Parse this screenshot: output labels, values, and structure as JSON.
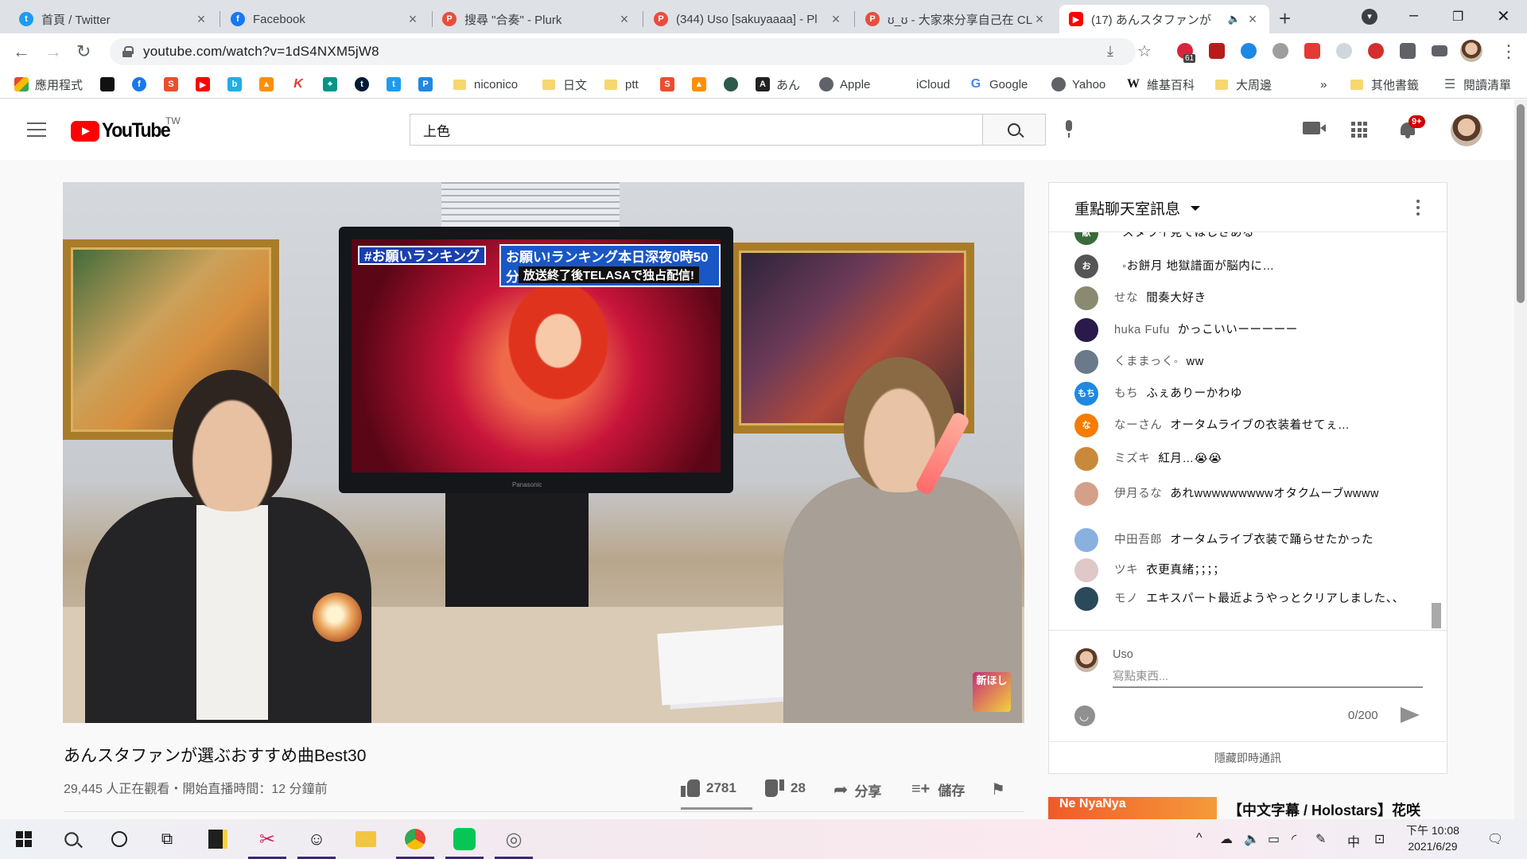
{
  "browser": {
    "tabs": [
      {
        "label": "首頁 / Twitter",
        "icon": "twitter-icon",
        "color": "#1d9bf0"
      },
      {
        "label": "Facebook",
        "icon": "facebook-icon",
        "color": "#1877f2"
      },
      {
        "label": "搜尋 \"合奏\" - Plurk",
        "icon": "plurk-icon",
        "color": "#e84e3c"
      },
      {
        "label": "(344) Uso [sakuyaaaa] - Pl",
        "icon": "plurk-icon",
        "color": "#e84e3c"
      },
      {
        "label": "ʊ_ʊ - 大家來分享自己在 CL",
        "icon": "plurk-icon",
        "color": "#e84e3c"
      },
      {
        "label": "(17) あんスタファンが",
        "icon": "youtube-icon",
        "color": "#ff0000",
        "active": true
      }
    ],
    "url": "youtube.com/watch?v=1dS4NXM5jW8",
    "extension_badge": "61",
    "bookmarks": [
      {
        "label": "應用程式",
        "icon": "apps-grid-icon"
      },
      {
        "label": "",
        "icon": "apple-black-icon"
      },
      {
        "label": "",
        "icon": "facebook-icon"
      },
      {
        "label": "",
        "icon": "shopping-bag-icon"
      },
      {
        "label": "",
        "icon": "youtube-icon"
      },
      {
        "label": "",
        "icon": "bilibili-icon"
      },
      {
        "label": "",
        "icon": "fire-icon"
      },
      {
        "label": "",
        "icon": "k-icon"
      },
      {
        "label": "",
        "icon": "map-icon"
      },
      {
        "label": "",
        "icon": "tumblr-icon"
      },
      {
        "label": "",
        "icon": "twitter-icon"
      },
      {
        "label": "",
        "icon": "p-icon"
      },
      {
        "label": "niconico",
        "icon": "folder-icon"
      },
      {
        "label": "日文",
        "icon": "folder-icon"
      },
      {
        "label": "ptt",
        "icon": "folder-icon"
      },
      {
        "label": "",
        "icon": "shopping-bag-icon"
      },
      {
        "label": "",
        "icon": "fire-icon"
      },
      {
        "label": "",
        "icon": "circle-icon"
      },
      {
        "label": "あん",
        "icon": "anime-icon"
      },
      {
        "label": "Apple",
        "icon": "globe-icon"
      },
      {
        "label": "iCloud",
        "icon": "apple-icon"
      },
      {
        "label": "Google",
        "icon": "google-icon"
      },
      {
        "label": "Yahoo",
        "icon": "globe-icon"
      },
      {
        "label": "維基百科",
        "icon": "wikipedia-icon"
      },
      {
        "label": "大周邊",
        "icon": "folder-icon"
      },
      {
        "label": "其他書籤",
        "icon": "folder-icon"
      },
      {
        "label": "閱讀清單",
        "icon": "reading-list-icon"
      }
    ],
    "bookmarks_more": "»"
  },
  "youtube": {
    "logo_text": "YouTube",
    "country": "TW",
    "search_value": "上色",
    "notifications_badge": "9+",
    "video": {
      "title": "あんスタファンが選ぶおすすめ曲Best30",
      "meta": "29,445 人正在觀看・開始直播時間：12 分鐘前",
      "likes": "2781",
      "dislikes": "28",
      "share_label": "分享",
      "save_label": "儲存",
      "tv_banner_1": "#お願いランキング",
      "tv_banner_2": "お願い!ランキング本日深夜0時50分~",
      "tv_banner_3": "放送終了後TELASAで独占配信!",
      "tv_brand": "Panasonic",
      "corner_logo": "新ほし"
    },
    "chat": {
      "title": "重點聊天室訊息",
      "messages": [
        {
          "author": "",
          "text": "スタライ見てほしさある",
          "avatar_color": "#3a6b3a",
          "avatar_text": "献"
        },
        {
          "author": "",
          "text": "◦お餅月 地獄譜面が脳内に…",
          "avatar_color": "#555555",
          "avatar_text": "お"
        },
        {
          "author": "せな",
          "text": "間奏大好き",
          "avatar_color": "#8a8a70",
          "avatar_text": ""
        },
        {
          "author": "huka Fufu",
          "text": "かっこいいーーーーー",
          "avatar_color": "#2a1a4a",
          "avatar_text": ""
        },
        {
          "author": "くままっく◦",
          "text": "ww",
          "avatar_color": "#6a7a8a",
          "avatar_text": ""
        },
        {
          "author": "もち",
          "text": "ふぇありーかわゆ",
          "avatar_color": "#1e88e5",
          "avatar_text": "もち"
        },
        {
          "author": "なーさん",
          "text": "オータムライブの衣装着せてぇ…",
          "avatar_color": "#f57c00",
          "avatar_text": "な"
        },
        {
          "author": "ミズキ",
          "text": "紅月…😭😭",
          "avatar_color": "#c88a3a",
          "avatar_text": ""
        },
        {
          "author": "伊月るな",
          "text": "あれwwwwwwwwwオタクムーブwwww",
          "avatar_color": "#d4a08a",
          "avatar_text": ""
        },
        {
          "author": "中田吾郎",
          "text": "オータムライブ衣装で踊らせたかった",
          "avatar_color": "#8ab0e0",
          "avatar_text": ""
        },
        {
          "author": "ツキ",
          "text": "衣更真緒；；；；",
          "avatar_color": "#e0c8c8",
          "avatar_text": ""
        },
        {
          "author": "モノ",
          "text": "エキスパート最近ようやっとクリアしました、、",
          "avatar_color": "#2a4a5a",
          "avatar_text": ""
        }
      ],
      "user_name": "Uso",
      "input_placeholder": "寫點東西...",
      "char_counter": "0/200",
      "hide_chat": "隱藏即時通訊"
    },
    "recommendation": {
      "thumb_text": "Ne NyaNya",
      "title": "【中文字幕 / Holostars】花咲"
    }
  },
  "taskbar": {
    "apps": [
      "windows-start-icon",
      "search-icon",
      "cortana-icon",
      "task-view-icon",
      "sticky-notes-icon",
      "snipping-tool-icon",
      "line-art-icon",
      "file-explorer-icon",
      "chrome-icon",
      "line-icon",
      "app-swirl-icon"
    ],
    "ime": "中",
    "time": "下午 10:08",
    "date": "2021/6/29"
  }
}
